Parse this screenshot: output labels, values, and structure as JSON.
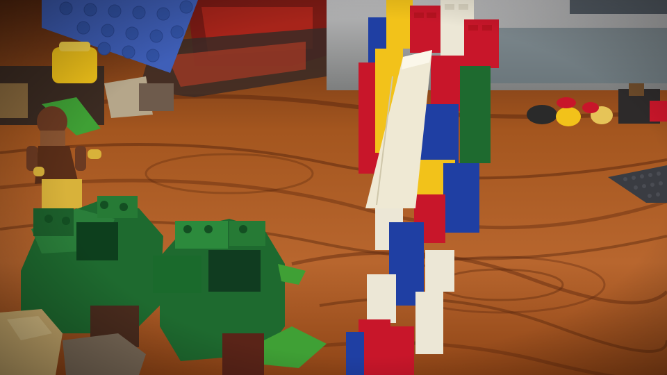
{
  "scene": {
    "colors": {
      "table_light": "#b8662e",
      "table_dark": "#6a2f12",
      "grain": "#4e200a",
      "brick_red": "#c8162a",
      "brick_blue": "#1f3fa3",
      "brick_yellow": "#f2c21a",
      "brick_white": "#ece7d6",
      "brick_green": "#1e6a2f",
      "brick_dark_green": "#0d3f1d",
      "baseplate_blue": "#3f5fb8",
      "baseplate_green": "#3fa035",
      "baseplate_gray": "#3a3c42",
      "tan": "#c9ab6e",
      "minifig_brown": "#6b3a22",
      "minifig_yellow": "#d8b23a"
    },
    "objects": [
      "blue-baseplate",
      "set-box",
      "storage-bin",
      "wooden-table",
      "minifigure",
      "green-tree-builds",
      "tan-bricks",
      "brick-tower",
      "white-plank",
      "loose-bricks",
      "gray-baseplate"
    ]
  }
}
